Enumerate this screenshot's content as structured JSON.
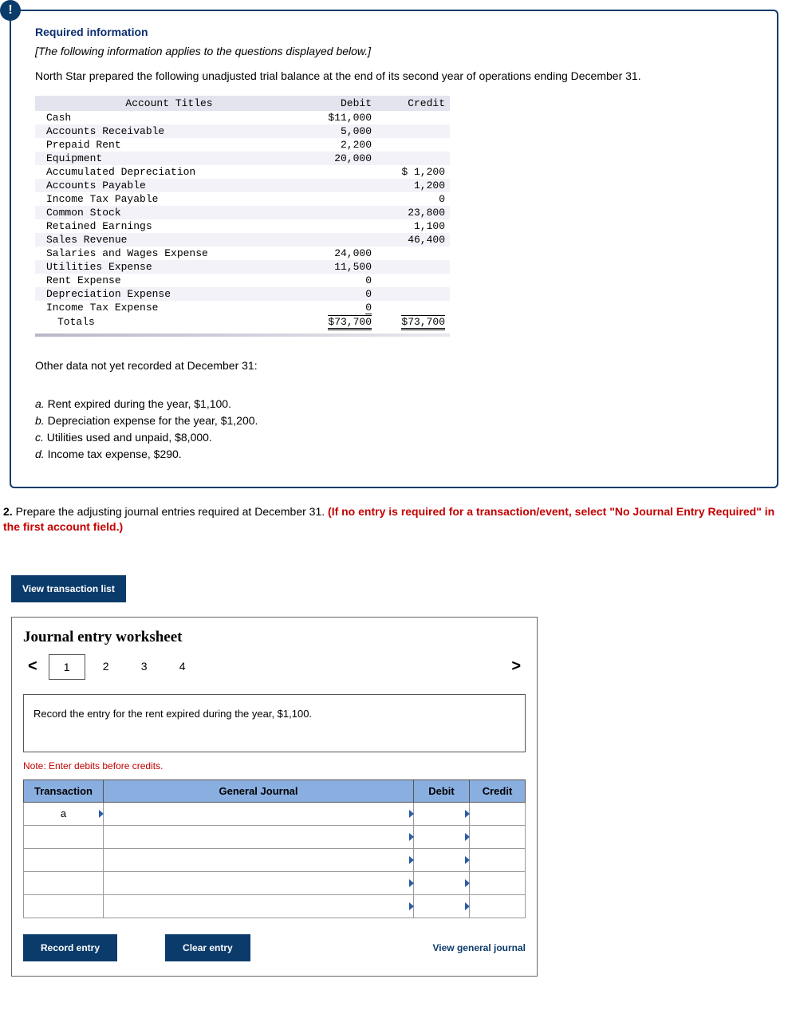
{
  "info": {
    "badge": "!",
    "title": "Required information",
    "subtitle": "[The following information applies to the questions displayed below.]",
    "para": "North Star prepared the following unadjusted trial balance at the end of its second year of operations ending December 31."
  },
  "trial_balance": {
    "headers": {
      "acct": "Account Titles",
      "debit": "Debit",
      "credit": "Credit"
    },
    "rows": [
      {
        "acct": "Cash",
        "debit": "$11,000",
        "credit": ""
      },
      {
        "acct": "Accounts Receivable",
        "debit": "5,000",
        "credit": ""
      },
      {
        "acct": "Prepaid Rent",
        "debit": "2,200",
        "credit": ""
      },
      {
        "acct": "Equipment",
        "debit": "20,000",
        "credit": ""
      },
      {
        "acct": "Accumulated Depreciation",
        "debit": "",
        "credit": "$ 1,200"
      },
      {
        "acct": "Accounts Payable",
        "debit": "",
        "credit": "1,200"
      },
      {
        "acct": "Income Tax Payable",
        "debit": "",
        "credit": "0"
      },
      {
        "acct": "Common Stock",
        "debit": "",
        "credit": "23,800"
      },
      {
        "acct": "Retained Earnings",
        "debit": "",
        "credit": "1,100"
      },
      {
        "acct": "Sales Revenue",
        "debit": "",
        "credit": "46,400"
      },
      {
        "acct": "Salaries and Wages Expense",
        "debit": "24,000",
        "credit": ""
      },
      {
        "acct": "Utilities Expense",
        "debit": "11,500",
        "credit": ""
      },
      {
        "acct": "Rent Expense",
        "debit": "0",
        "credit": ""
      },
      {
        "acct": "Depreciation Expense",
        "debit": "0",
        "credit": ""
      },
      {
        "acct": "Income Tax Expense",
        "debit": "0",
        "credit": ""
      }
    ],
    "totals": {
      "label": "Totals",
      "debit": "$73,700",
      "credit": "$73,700"
    }
  },
  "other_data_heading": "Other data not yet recorded at December 31:",
  "items": [
    {
      "lbl": "a.",
      "txt": " Rent expired during the year, $1,100."
    },
    {
      "lbl": "b.",
      "txt": " Depreciation expense for the year, $1,200."
    },
    {
      "lbl": "c.",
      "txt": " Utilities used and unpaid, $8,000."
    },
    {
      "lbl": "d.",
      "txt": " Income tax expense, $290."
    }
  ],
  "q2": {
    "num": "2. ",
    "black": "Prepare the adjusting journal entries required at December 31. ",
    "red": "(If no entry is required for a transaction/event, select \"No Journal Entry Required\" in the first account field.)"
  },
  "vt_button": "View transaction list",
  "worksheet": {
    "title": "Journal entry worksheet",
    "tabs": [
      "1",
      "2",
      "3",
      "4"
    ],
    "chev_left": "<",
    "chev_right": ">",
    "prompt": "Record the entry for the rent expired during the year, $1,100.",
    "note": "Note: Enter debits before credits.",
    "headers": {
      "tr": "Transaction",
      "gj": "General Journal",
      "db": "Debit",
      "cr": "Credit"
    },
    "first_tr": "a",
    "buttons": {
      "record": "Record entry",
      "clear": "Clear entry",
      "view": "View general journal"
    }
  }
}
